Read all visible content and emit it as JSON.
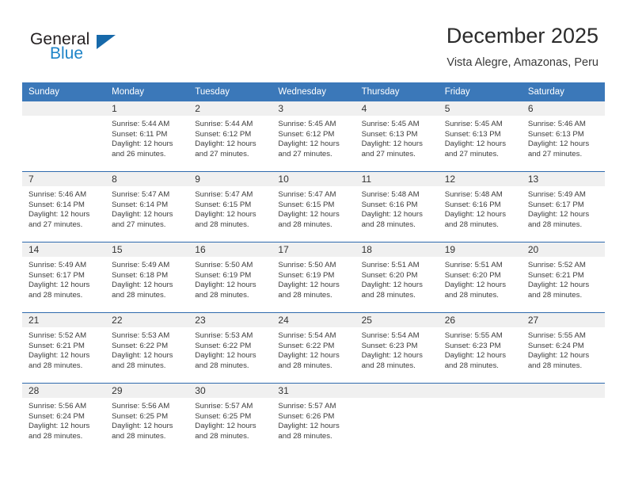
{
  "logo": {
    "word_one": "General",
    "word_two": "Blue",
    "triangle_color": "#1769aa",
    "blue_color": "#1e84c8"
  },
  "header": {
    "title": "December 2025",
    "subtitle": "Vista Alegre, Amazonas, Peru"
  },
  "theme": {
    "header_row_bg": "#3b78b9",
    "header_row_text": "#ffffff",
    "daynum_band_bg": "#f0f0f0",
    "week_separator": "#2f6aad",
    "body_text": "#3c3c3c"
  },
  "calendar": {
    "weekday_headers": [
      "Sunday",
      "Monday",
      "Tuesday",
      "Wednesday",
      "Thursday",
      "Friday",
      "Saturday"
    ],
    "weeks": [
      [
        {
          "day": "",
          "sunrise": "",
          "sunset": "",
          "daylight": ""
        },
        {
          "day": "1",
          "sunrise": "Sunrise: 5:44 AM",
          "sunset": "Sunset: 6:11 PM",
          "daylight": "Daylight: 12 hours and 26 minutes."
        },
        {
          "day": "2",
          "sunrise": "Sunrise: 5:44 AM",
          "sunset": "Sunset: 6:12 PM",
          "daylight": "Daylight: 12 hours and 27 minutes."
        },
        {
          "day": "3",
          "sunrise": "Sunrise: 5:45 AM",
          "sunset": "Sunset: 6:12 PM",
          "daylight": "Daylight: 12 hours and 27 minutes."
        },
        {
          "day": "4",
          "sunrise": "Sunrise: 5:45 AM",
          "sunset": "Sunset: 6:13 PM",
          "daylight": "Daylight: 12 hours and 27 minutes."
        },
        {
          "day": "5",
          "sunrise": "Sunrise: 5:45 AM",
          "sunset": "Sunset: 6:13 PM",
          "daylight": "Daylight: 12 hours and 27 minutes."
        },
        {
          "day": "6",
          "sunrise": "Sunrise: 5:46 AM",
          "sunset": "Sunset: 6:13 PM",
          "daylight": "Daylight: 12 hours and 27 minutes."
        }
      ],
      [
        {
          "day": "7",
          "sunrise": "Sunrise: 5:46 AM",
          "sunset": "Sunset: 6:14 PM",
          "daylight": "Daylight: 12 hours and 27 minutes."
        },
        {
          "day": "8",
          "sunrise": "Sunrise: 5:47 AM",
          "sunset": "Sunset: 6:14 PM",
          "daylight": "Daylight: 12 hours and 27 minutes."
        },
        {
          "day": "9",
          "sunrise": "Sunrise: 5:47 AM",
          "sunset": "Sunset: 6:15 PM",
          "daylight": "Daylight: 12 hours and 28 minutes."
        },
        {
          "day": "10",
          "sunrise": "Sunrise: 5:47 AM",
          "sunset": "Sunset: 6:15 PM",
          "daylight": "Daylight: 12 hours and 28 minutes."
        },
        {
          "day": "11",
          "sunrise": "Sunrise: 5:48 AM",
          "sunset": "Sunset: 6:16 PM",
          "daylight": "Daylight: 12 hours and 28 minutes."
        },
        {
          "day": "12",
          "sunrise": "Sunrise: 5:48 AM",
          "sunset": "Sunset: 6:16 PM",
          "daylight": "Daylight: 12 hours and 28 minutes."
        },
        {
          "day": "13",
          "sunrise": "Sunrise: 5:49 AM",
          "sunset": "Sunset: 6:17 PM",
          "daylight": "Daylight: 12 hours and 28 minutes."
        }
      ],
      [
        {
          "day": "14",
          "sunrise": "Sunrise: 5:49 AM",
          "sunset": "Sunset: 6:17 PM",
          "daylight": "Daylight: 12 hours and 28 minutes."
        },
        {
          "day": "15",
          "sunrise": "Sunrise: 5:49 AM",
          "sunset": "Sunset: 6:18 PM",
          "daylight": "Daylight: 12 hours and 28 minutes."
        },
        {
          "day": "16",
          "sunrise": "Sunrise: 5:50 AM",
          "sunset": "Sunset: 6:19 PM",
          "daylight": "Daylight: 12 hours and 28 minutes."
        },
        {
          "day": "17",
          "sunrise": "Sunrise: 5:50 AM",
          "sunset": "Sunset: 6:19 PM",
          "daylight": "Daylight: 12 hours and 28 minutes."
        },
        {
          "day": "18",
          "sunrise": "Sunrise: 5:51 AM",
          "sunset": "Sunset: 6:20 PM",
          "daylight": "Daylight: 12 hours and 28 minutes."
        },
        {
          "day": "19",
          "sunrise": "Sunrise: 5:51 AM",
          "sunset": "Sunset: 6:20 PM",
          "daylight": "Daylight: 12 hours and 28 minutes."
        },
        {
          "day": "20",
          "sunrise": "Sunrise: 5:52 AM",
          "sunset": "Sunset: 6:21 PM",
          "daylight": "Daylight: 12 hours and 28 minutes."
        }
      ],
      [
        {
          "day": "21",
          "sunrise": "Sunrise: 5:52 AM",
          "sunset": "Sunset: 6:21 PM",
          "daylight": "Daylight: 12 hours and 28 minutes."
        },
        {
          "day": "22",
          "sunrise": "Sunrise: 5:53 AM",
          "sunset": "Sunset: 6:22 PM",
          "daylight": "Daylight: 12 hours and 28 minutes."
        },
        {
          "day": "23",
          "sunrise": "Sunrise: 5:53 AM",
          "sunset": "Sunset: 6:22 PM",
          "daylight": "Daylight: 12 hours and 28 minutes."
        },
        {
          "day": "24",
          "sunrise": "Sunrise: 5:54 AM",
          "sunset": "Sunset: 6:22 PM",
          "daylight": "Daylight: 12 hours and 28 minutes."
        },
        {
          "day": "25",
          "sunrise": "Sunrise: 5:54 AM",
          "sunset": "Sunset: 6:23 PM",
          "daylight": "Daylight: 12 hours and 28 minutes."
        },
        {
          "day": "26",
          "sunrise": "Sunrise: 5:55 AM",
          "sunset": "Sunset: 6:23 PM",
          "daylight": "Daylight: 12 hours and 28 minutes."
        },
        {
          "day": "27",
          "sunrise": "Sunrise: 5:55 AM",
          "sunset": "Sunset: 6:24 PM",
          "daylight": "Daylight: 12 hours and 28 minutes."
        }
      ],
      [
        {
          "day": "28",
          "sunrise": "Sunrise: 5:56 AM",
          "sunset": "Sunset: 6:24 PM",
          "daylight": "Daylight: 12 hours and 28 minutes."
        },
        {
          "day": "29",
          "sunrise": "Sunrise: 5:56 AM",
          "sunset": "Sunset: 6:25 PM",
          "daylight": "Daylight: 12 hours and 28 minutes."
        },
        {
          "day": "30",
          "sunrise": "Sunrise: 5:57 AM",
          "sunset": "Sunset: 6:25 PM",
          "daylight": "Daylight: 12 hours and 28 minutes."
        },
        {
          "day": "31",
          "sunrise": "Sunrise: 5:57 AM",
          "sunset": "Sunset: 6:26 PM",
          "daylight": "Daylight: 12 hours and 28 minutes."
        },
        {
          "day": "",
          "sunrise": "",
          "sunset": "",
          "daylight": ""
        },
        {
          "day": "",
          "sunrise": "",
          "sunset": "",
          "daylight": ""
        },
        {
          "day": "",
          "sunrise": "",
          "sunset": "",
          "daylight": ""
        }
      ]
    ]
  }
}
